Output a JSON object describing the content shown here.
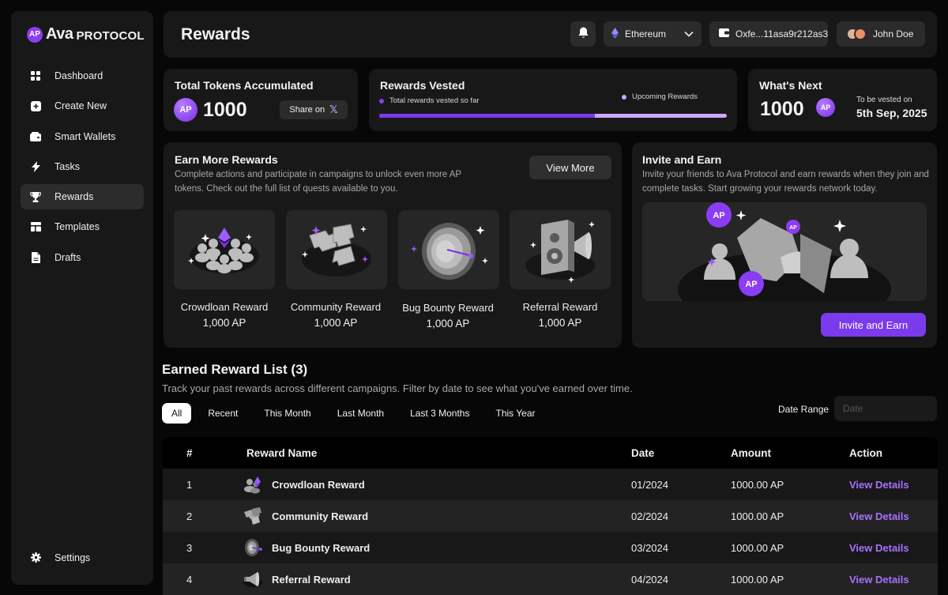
{
  "brand": {
    "logo_mark": "AP",
    "name_primary": "Ava",
    "name_secondary": "PROTOCOL"
  },
  "sidebar": {
    "items": [
      {
        "label": "Dashboard",
        "icon": "grid-icon"
      },
      {
        "label": "Create New",
        "icon": "plus-square-icon"
      },
      {
        "label": "Smart Wallets",
        "icon": "wallet-icon"
      },
      {
        "label": "Tasks",
        "icon": "bolt-icon"
      },
      {
        "label": "Rewards",
        "icon": "trophy-icon",
        "active": true
      },
      {
        "label": "Templates",
        "icon": "layout-icon"
      },
      {
        "label": "Drafts",
        "icon": "document-icon"
      }
    ],
    "settings_label": "Settings"
  },
  "header": {
    "title": "Rewards",
    "network": "Ethereum",
    "wallet_address": "Oxfe...11asa9r212as3",
    "user_name": "John Doe"
  },
  "total_tokens": {
    "title": "Total Tokens Accumulated",
    "value": "1000",
    "share_label": "Share on"
  },
  "vesting": {
    "title": "Rewards Vested",
    "legend_vested": "Total rewards vested so far",
    "legend_upcoming": "Upcoming Rewards",
    "vested_fraction": 0.62
  },
  "whats_next": {
    "title": "What's Next",
    "value": "1000",
    "caption": "To be vested on",
    "date": "5th Sep, 2025"
  },
  "earn_more": {
    "title": "Earn More Rewards",
    "description": "Complete actions and participate in campaigns to unlock even more AP tokens. Check out the full list of quests available to you.",
    "view_more_label": "View More",
    "tiles": [
      {
        "name": "Crowdloan Reward",
        "value": "1,000 AP"
      },
      {
        "name": "Community Reward",
        "value": "1,000 AP"
      },
      {
        "name": "Bug Bounty Reward",
        "value": "1,000 AP"
      },
      {
        "name": "Referral Reward",
        "value": "1,000 AP"
      }
    ]
  },
  "invite": {
    "title": "Invite and Earn",
    "description": "Invite your friends to Ava Protocol and earn rewards when they join and complete tasks. Start growing your rewards network today.",
    "button_label": "Invite and Earn"
  },
  "earned_list": {
    "title": "Earned Reward List (3)",
    "subtitle": "Track your past rewards across different campaigns. Filter by date to see what you've earned over time.",
    "filters": [
      "All",
      "Recent",
      "This Month",
      "Last Month",
      "Last 3 Months",
      "This Year"
    ],
    "active_filter": "All",
    "date_range_label": "Date Range",
    "date_placeholder": "Date",
    "columns": [
      "#",
      "Reward Name",
      "Date",
      "Amount",
      "Action"
    ],
    "rows": [
      {
        "num": "1",
        "name": "Crowdloan Reward",
        "date": "01/2024",
        "amount": "1000.00 AP",
        "action": "View Details"
      },
      {
        "num": "2",
        "name": "Community Reward",
        "date": "02/2024",
        "amount": "1000.00 AP",
        "action": "View Details"
      },
      {
        "num": "3",
        "name": "Bug Bounty Reward",
        "date": "03/2024",
        "amount": "1000.00 AP",
        "action": "View Details"
      },
      {
        "num": "4",
        "name": "Referral Reward",
        "date": "04/2024",
        "amount": "1000.00 AP",
        "action": "View Details"
      }
    ]
  },
  "colors": {
    "accent": "#7c3aed",
    "accent_light": "#c9a8ff",
    "link": "#a870ff",
    "panel": "#181818",
    "background": "#070707"
  }
}
